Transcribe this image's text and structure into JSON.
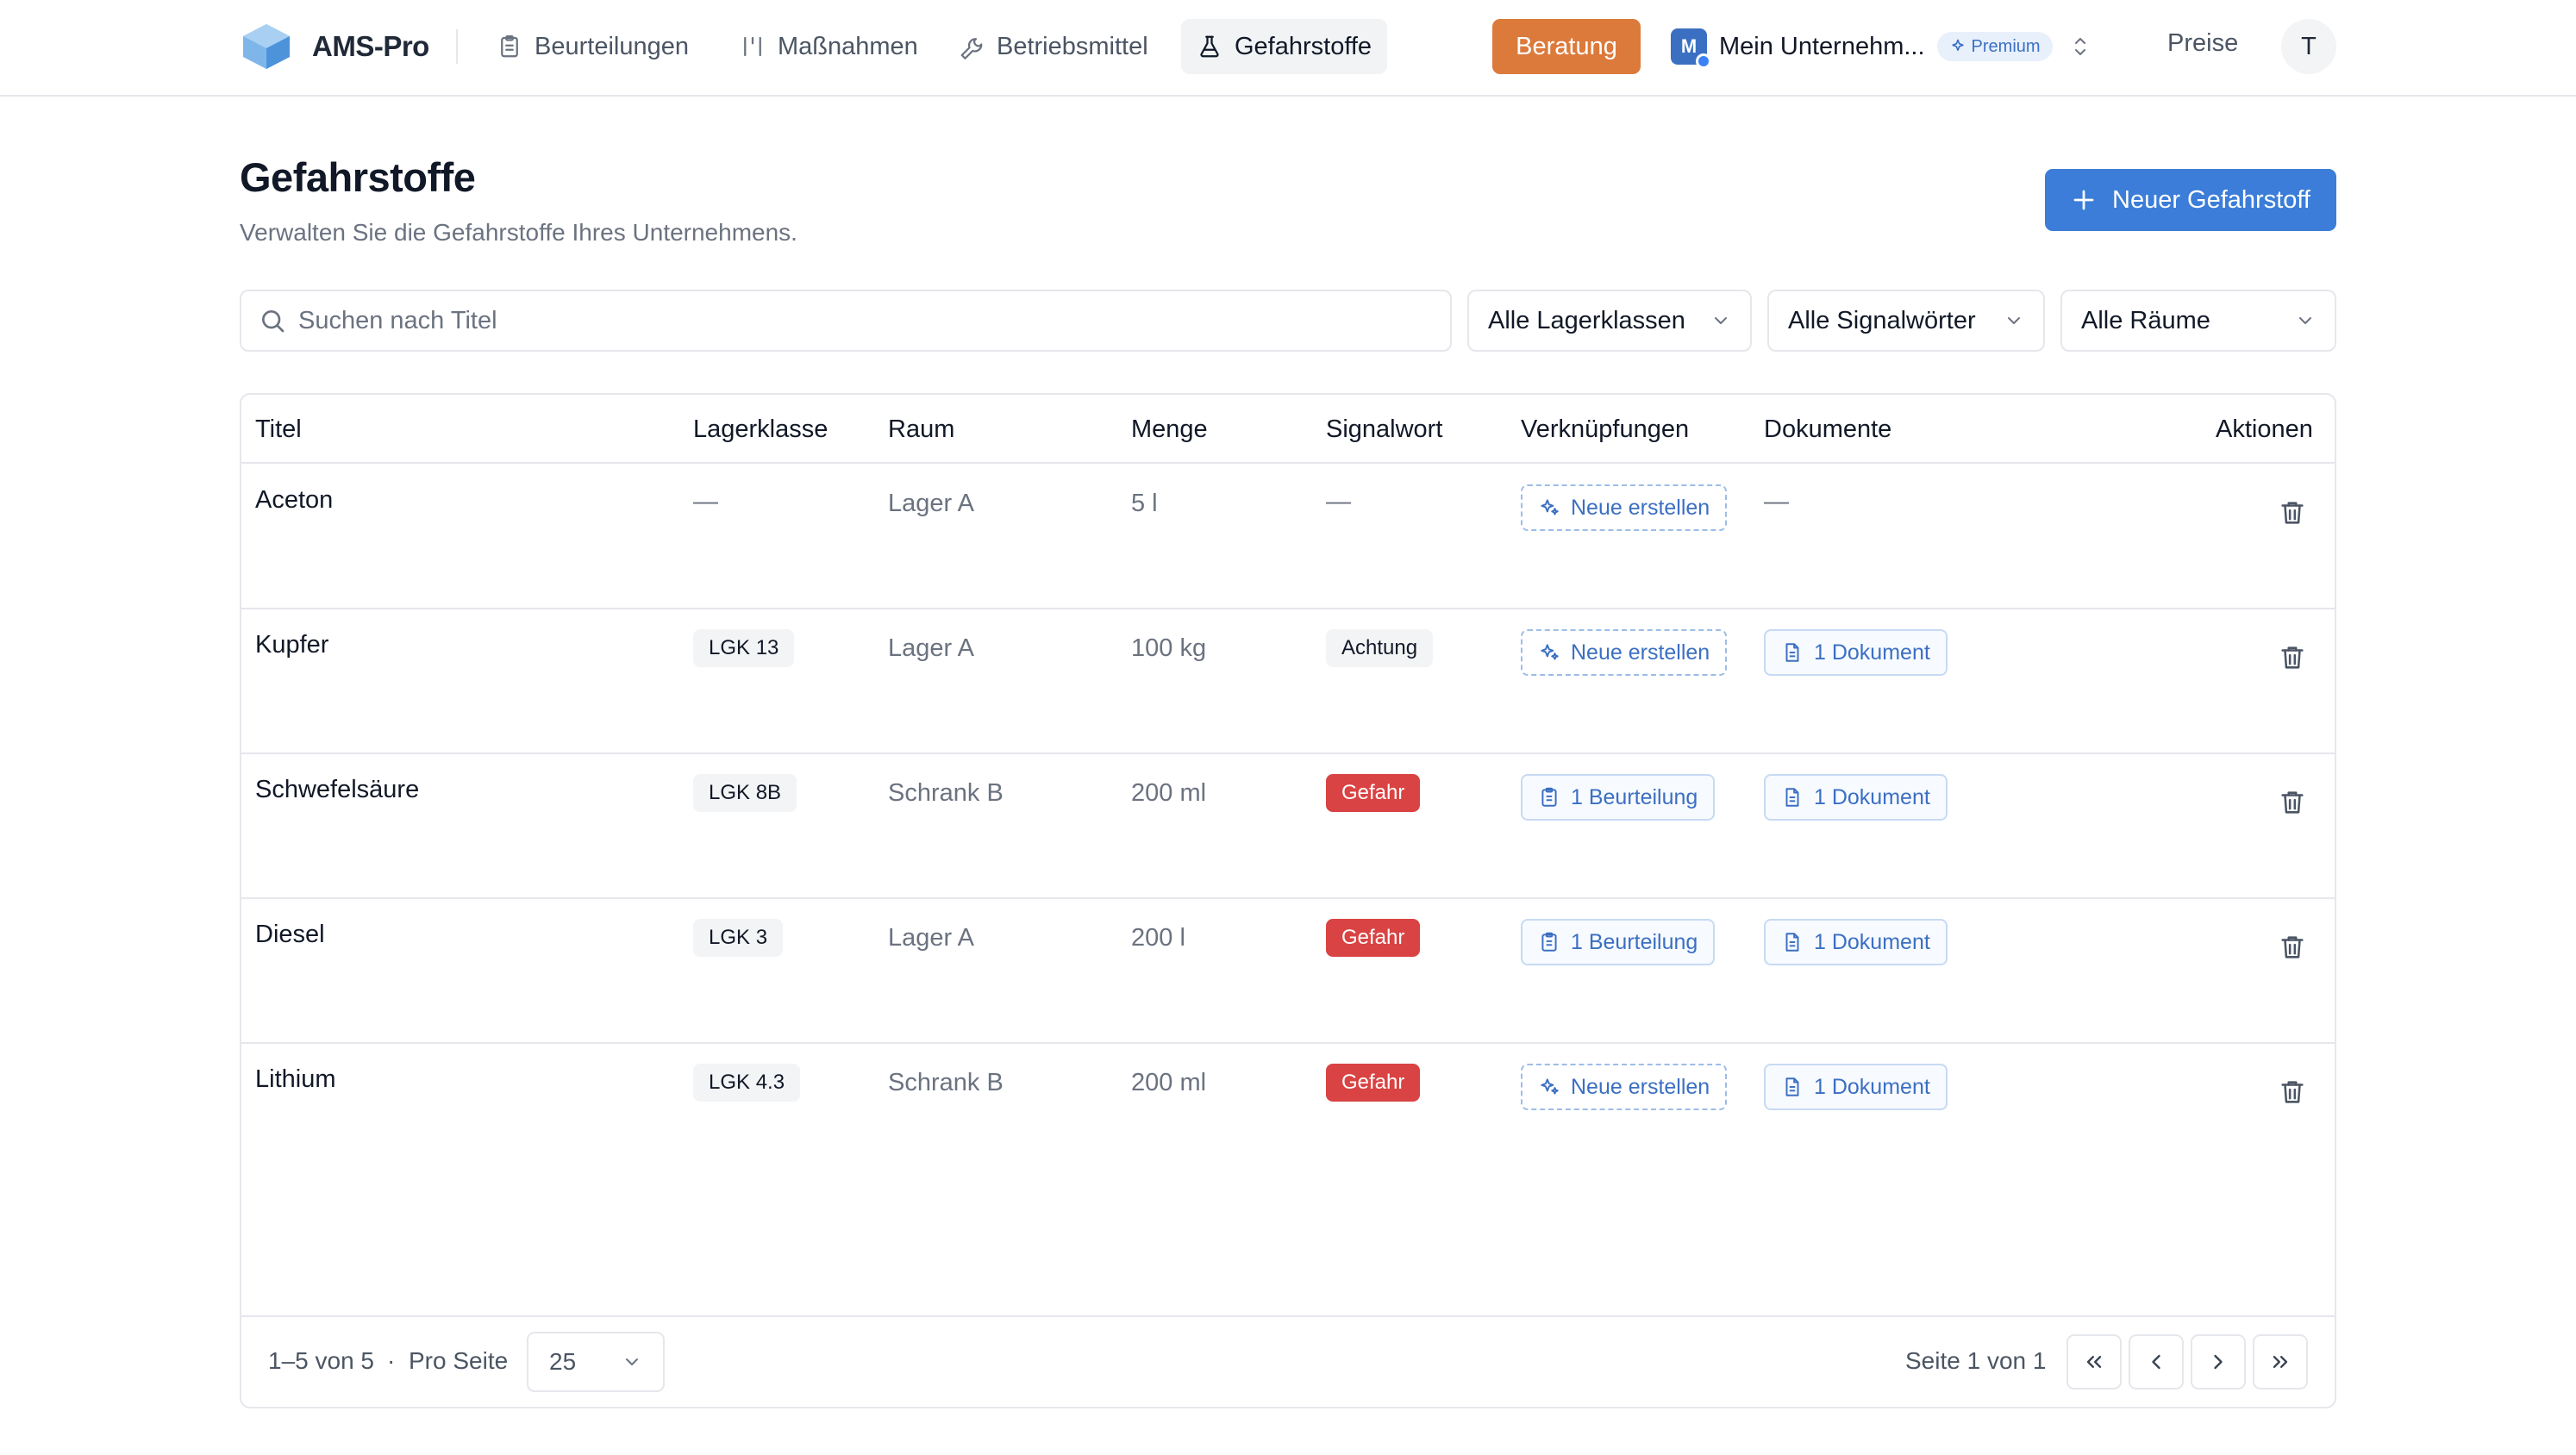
{
  "app": {
    "name": "AMS-Pro"
  },
  "nav": {
    "items": [
      {
        "label": "Beurteilungen",
        "icon": "clipboard-icon"
      },
      {
        "label": "Maßnahmen",
        "icon": "measures-icon"
      },
      {
        "label": "Betriebsmittel",
        "icon": "wrench-icon"
      },
      {
        "label": "Gefahrstoffe",
        "icon": "flask-icon",
        "active": true
      }
    ]
  },
  "header": {
    "beratung_label": "Beratung",
    "company_initial": "M",
    "company_name": "Mein Unternehm...",
    "premium_label": "Premium",
    "preise_label": "Preise",
    "user_initial": "T"
  },
  "page": {
    "title": "Gefahrstoffe",
    "subtitle": "Verwalten Sie die Gefahrstoffe Ihres Unternehmens.",
    "new_button_label": "Neuer Gefahrstoff"
  },
  "filters": {
    "search_placeholder": "Suchen nach Titel",
    "search_value": "",
    "lagerklasse": "Alle Lagerklassen",
    "signalwort": "Alle Signalwörter",
    "raum": "Alle Räume"
  },
  "table": {
    "columns": [
      "Titel",
      "Lagerklasse",
      "Raum",
      "Menge",
      "Signalwort",
      "Verknüpfungen",
      "Dokumente",
      "Aktionen"
    ],
    "rows": [
      {
        "titel": "Aceton",
        "lagerklasse": "—",
        "raum": "Lager A",
        "menge": "5 l",
        "signalwort": "—",
        "signal_type": "none",
        "link": "Neue erstellen",
        "link_type": "create",
        "dokumente": "—"
      },
      {
        "titel": "Kupfer",
        "lagerklasse": "LGK 13",
        "raum": "Lager A",
        "menge": "100 kg",
        "signalwort": "Achtung",
        "signal_type": "warning",
        "link": "Neue erstellen",
        "link_type": "create",
        "dokumente": "1 Dokument"
      },
      {
        "titel": "Schwefelsäure",
        "lagerklasse": "LGK 8B",
        "raum": "Schrank B",
        "menge": "200 ml",
        "signalwort": "Gefahr",
        "signal_type": "danger",
        "link": "1 Beurteilung",
        "link_type": "existing",
        "dokumente": "1 Dokument"
      },
      {
        "titel": "Diesel",
        "lagerklasse": "LGK 3",
        "raum": "Lager A",
        "menge": "200 l",
        "signalwort": "Gefahr",
        "signal_type": "danger",
        "link": "1 Beurteilung",
        "link_type": "existing",
        "dokumente": "1 Dokument"
      },
      {
        "titel": "Lithium",
        "lagerklasse": "LGK 4.3",
        "raum": "Schrank B",
        "menge": "200 ml",
        "signalwort": "Gefahr",
        "signal_type": "danger",
        "link": "Neue erstellen",
        "link_type": "create",
        "dokumente": "1 Dokument"
      }
    ]
  },
  "pagination": {
    "range_label": "1–5 von 5",
    "separator": "·",
    "per_page_label": "Pro Seite",
    "per_page_value": "25",
    "page_label": "Seite 1 von 1"
  },
  "colors": {
    "accent": "#3b7dd8",
    "beratung": "#dc7a3b",
    "danger": "#d94343",
    "link": "#3b6fc2"
  }
}
